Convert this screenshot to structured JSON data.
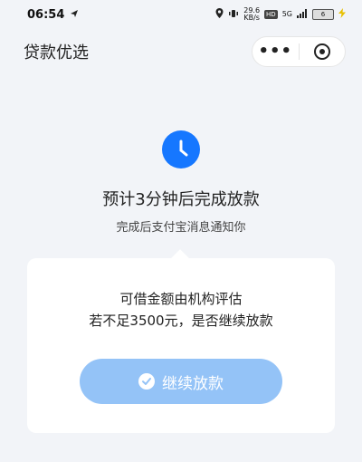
{
  "statusbar": {
    "time": "06:54",
    "net_speed_top": "29.6",
    "net_speed_bottom": "KB/s",
    "hd": "HD",
    "signal": "5G",
    "battery": "6"
  },
  "header": {
    "title": "贷款优选",
    "more_label": "•••"
  },
  "main": {
    "headline": "预计3分钟后完成放款",
    "subline": "完成后支付宝消息通知你"
  },
  "card": {
    "line1": "可借金额由机构评估",
    "line2": "若不足3500元，是否继续放款",
    "button_label": "继续放款"
  },
  "colors": {
    "accent": "#1677ff",
    "button": "#94c3f7",
    "background": "#f2f4f8"
  }
}
